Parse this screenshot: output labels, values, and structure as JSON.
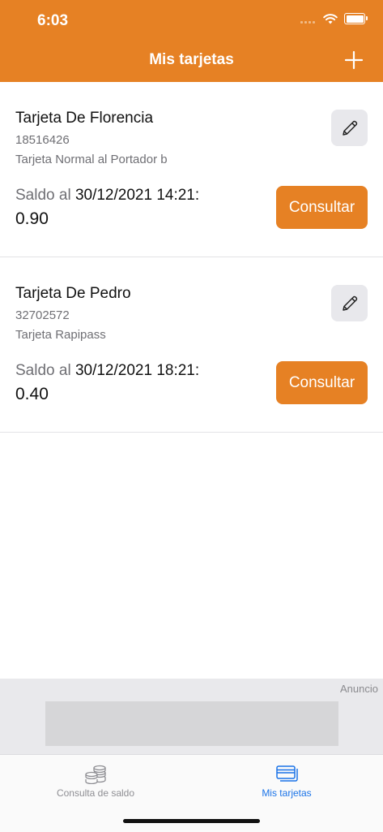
{
  "status": {
    "time": "6:03"
  },
  "header": {
    "title": "Mis tarjetas"
  },
  "cards": [
    {
      "name": "Tarjeta De Florencia",
      "number": "18516426",
      "type": "Tarjeta Normal al Portador b",
      "balance_prefix": "Saldo al ",
      "balance_date": "30/12/2021 14:21:",
      "balance_amount": "0.90",
      "consult_label": "Consultar"
    },
    {
      "name": "Tarjeta De Pedro",
      "number": "32702572",
      "type": "Tarjeta Rapipass",
      "balance_prefix": "Saldo al ",
      "balance_date": "30/12/2021 18:21:",
      "balance_amount": "0.40",
      "consult_label": "Consultar"
    }
  ],
  "ad": {
    "label": "Anuncio"
  },
  "tabs": [
    {
      "label": "Consulta de saldo",
      "icon": "coins-stack-icon",
      "active": false
    },
    {
      "label": "Mis tarjetas",
      "icon": "credit-card-icon",
      "active": true
    }
  ],
  "colors": {
    "accent": "#E68124",
    "tab_active": "#1a73e8",
    "tab_inactive": "#8e8e93"
  }
}
